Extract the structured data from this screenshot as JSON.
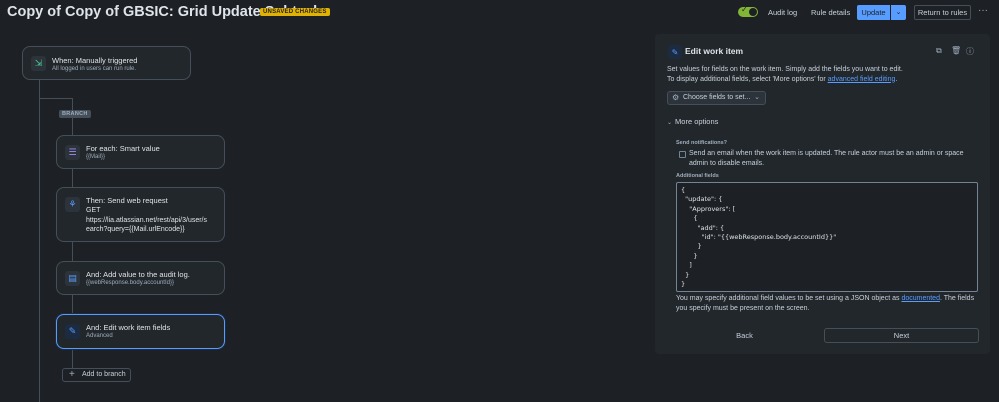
{
  "header": {
    "title": "Copy of Copy of GBSIC: Grid Update Subtasks",
    "unsaved_badge": "UNSAVED CHANGES",
    "audit_log": "Audit log",
    "rule_details": "Rule details",
    "update": "Update",
    "return_to_rules": "Return to rules"
  },
  "flow": {
    "trigger": {
      "title": "When: Manually triggered",
      "subtitle": "All logged in users can run rule."
    },
    "branch_badge": "BRANCH",
    "for_each": {
      "title": "For each: Smart value",
      "subtitle": "{{Mail}}"
    },
    "web_request": {
      "title": "Then: Send web request",
      "method": "GET",
      "url_line1": "https://lia.atlassian.net/rest/api/3/user/s",
      "url_line2": "earch?query={{Mail.urlEncode}}"
    },
    "audit_log_action": {
      "title": "And: Add value to the audit log.",
      "subtitle": "{{webResponse.body.accountId}}"
    },
    "edit_fields": {
      "title": "And: Edit work item fields",
      "subtitle": "Advanced"
    },
    "add_to_branch": "Add to branch"
  },
  "panel": {
    "title": "Edit work item",
    "desc_line1": "Set values for fields on the work item. Simply add the fields you want to edit.",
    "desc_line2_prefix": "To display additional fields, select 'More options' for ",
    "desc_link": "advanced field editing",
    "desc_suffix": ".",
    "choose_fields": "Choose fields to set...",
    "more_options": "More options",
    "send_notifications_label": "Send notifications?",
    "send_notifications_text": "Send an email when the work item is updated. The rule actor must be an admin or space admin to disable emails.",
    "additional_fields_label": "Additional fields",
    "json": "{\n  \"update\": {\n    \"Approvers\": [\n      {\n        \"add\": {\n          \"id\": \"{{webResponse.body.accountId}}\"\n        }\n      }\n    ]\n  }\n}",
    "hint_prefix": "You may specify additional field values to be set using a JSON object as ",
    "hint_link": "documented",
    "hint_suffix": ". The fields you specify must be present on the screen.",
    "back": "Back",
    "next": "Next"
  },
  "colors": {
    "background": "#1d2125",
    "card": "#22272b",
    "accent": "#579dff",
    "unsaved": "#e2b203",
    "toggle_on": "#82b536"
  }
}
